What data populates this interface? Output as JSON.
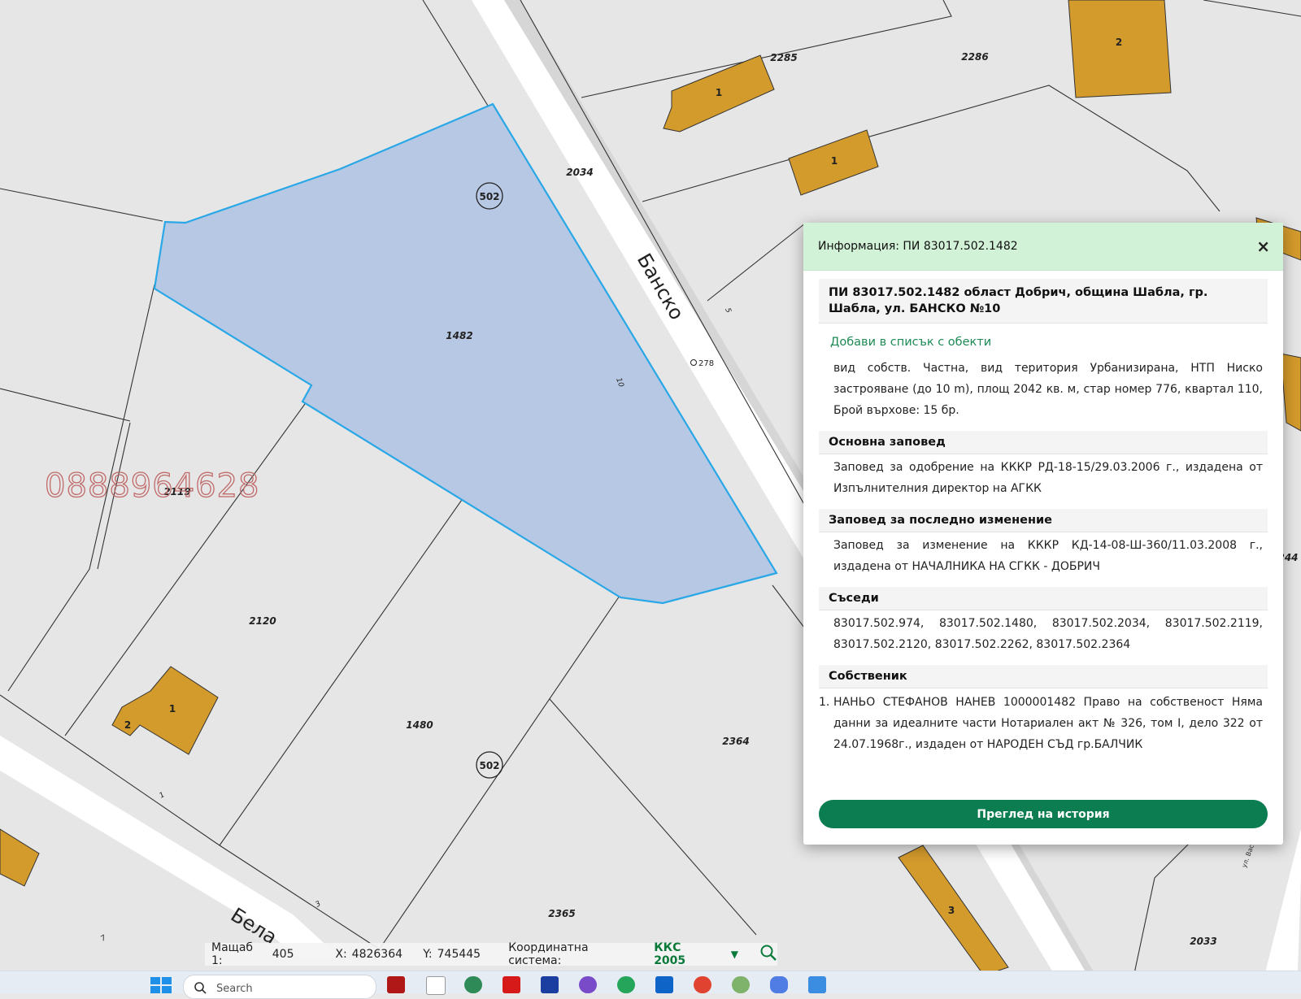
{
  "map": {
    "parcel_labels": [
      "1482",
      "2034",
      "2285",
      "2286",
      "2119",
      "2120",
      "1480",
      "2364",
      "2365",
      "2033",
      "244"
    ],
    "quarter_labels": [
      "502",
      "502"
    ],
    "point_label": "278",
    "small_labels": [
      "10",
      "5",
      "1",
      "3",
      "7"
    ],
    "building_labels": [
      "1",
      "1",
      "2",
      "1",
      "2",
      "3"
    ],
    "streets": [
      "Банско",
      "Бела",
      "ул. Вас"
    ],
    "watermark": "0888964628",
    "colors": {
      "selected_fill": "#b7c8e4",
      "selected_stroke": "#29a7e6",
      "building": "#d39a2c",
      "road": "#ffffff",
      "background": "#e6e6e6"
    }
  },
  "panel": {
    "title": "Информация: ПИ 83017.502.1482",
    "close_icon": "×",
    "heading": "ПИ 83017.502.1482 област Добрич, община Шабла, гр. Шабла, ул. БАНСКО №10",
    "add_link": "Добави в списък с обекти",
    "details": "вид собств. Частна, вид територия Урбанизирана, НТП Ниско застрояване (до 10 m), площ 2042 кв. м, стар номер 776, квартал 110, Брой върхове: 15 бр.",
    "sections": [
      {
        "title": "Основна заповед",
        "text": "Заповед за одобрение на КККР РД-18-15/29.03.2006 г., издадена от Изпълнителния директор на АГКК"
      },
      {
        "title": "Заповед за последно изменение",
        "text": "Заповед за изменение на КККР КД-14-08-Ш-360/11.03.2008 г., издадена от НАЧАЛНИКА НА СГКК - ДОБРИЧ"
      },
      {
        "title": "Съседи",
        "text": "83017.502.974, 83017.502.1480, 83017.502.2034, 83017.502.2119, 83017.502.2120, 83017.502.2262, 83017.502.2364"
      }
    ],
    "owner_title": "Собственик",
    "owner_number": "1.",
    "owner_text": "НАНЬО СТЕФАНОВ НАНЕВ 1000001482 Право на собственост Няма данни за идеалните части Нотариален акт № 326, том I, дело 322 от 24.07.1968г., издаден от НАРОДЕН СЪД гр.БАЛЧИК",
    "history_button": "Преглед на история"
  },
  "status": {
    "scale_label": "Мащаб 1:",
    "scale_value": "405",
    "x_label": "X:",
    "x_value": "4826364",
    "y_label": "Y:",
    "y_value": "745445",
    "coord_label": "Координатна система:",
    "coord_value": "ККС 2005",
    "dropdown_icon": "▼",
    "accent": "#0a7a3a"
  },
  "taskbar": {
    "search_placeholder": "Search",
    "icons": [
      "windows-start-icon",
      "search-icon",
      "app-icon",
      "file-icon",
      "browser-icon",
      "app-red-icon",
      "app-blue-icon",
      "viber-icon",
      "whatsapp-icon",
      "outlook-icon",
      "chrome-icon",
      "app-green-icon",
      "copilot-icon",
      "app-icon"
    ]
  }
}
